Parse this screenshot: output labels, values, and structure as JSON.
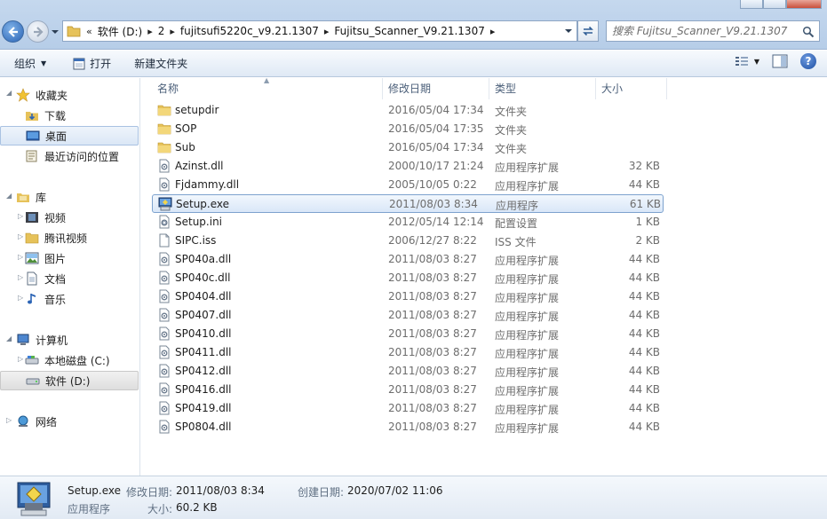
{
  "address": {
    "crumbs": [
      "软件 (D:)",
      "2",
      "fujitsufi5220c_v9.21.1307",
      "Fujitsu_Scanner_V9.21.1307"
    ],
    "overflow": "«"
  },
  "search": {
    "placeholder": "搜索 Fujitsu_Scanner_V9.21.1307"
  },
  "toolbar": {
    "organize": "组织",
    "open": "打开",
    "new_folder": "新建文件夹"
  },
  "nav": {
    "favorites": "收藏夹",
    "downloads": "下载",
    "desktop": "桌面",
    "recent": "最近访问的位置",
    "libraries": "库",
    "videos": "视频",
    "tencent_video": "腾讯视频",
    "pictures": "图片",
    "documents": "文档",
    "music": "音乐",
    "computer": "计算机",
    "local_disk": "本地磁盘 (C:)",
    "soft_disk": "软件 (D:)",
    "network": "网络"
  },
  "columns": {
    "name": "名称",
    "date": "修改日期",
    "type": "类型",
    "size": "大小"
  },
  "files": [
    {
      "name": "setupdir",
      "date": "2016/05/04 17:34",
      "type": "文件夹",
      "size": "",
      "icon": "folder"
    },
    {
      "name": "SOP",
      "date": "2016/05/04 17:35",
      "type": "文件夹",
      "size": "",
      "icon": "folder"
    },
    {
      "name": "Sub",
      "date": "2016/05/04 17:34",
      "type": "文件夹",
      "size": "",
      "icon": "folder"
    },
    {
      "name": "Azinst.dll",
      "date": "2000/10/17 21:24",
      "type": "应用程序扩展",
      "size": "32 KB",
      "icon": "dll"
    },
    {
      "name": "Fjdammy.dll",
      "date": "2005/10/05 0:22",
      "type": "应用程序扩展",
      "size": "44 KB",
      "icon": "dll"
    },
    {
      "name": "Setup.exe",
      "date": "2011/08/03 8:34",
      "type": "应用程序",
      "size": "61 KB",
      "icon": "exe"
    },
    {
      "name": "Setup.ini",
      "date": "2012/05/14 12:14",
      "type": "配置设置",
      "size": "1 KB",
      "icon": "ini"
    },
    {
      "name": "SIPC.iss",
      "date": "2006/12/27 8:22",
      "type": "ISS 文件",
      "size": "2 KB",
      "icon": "blank"
    },
    {
      "name": "SP040a.dll",
      "date": "2011/08/03 8:27",
      "type": "应用程序扩展",
      "size": "44 KB",
      "icon": "dll"
    },
    {
      "name": "SP040c.dll",
      "date": "2011/08/03 8:27",
      "type": "应用程序扩展",
      "size": "44 KB",
      "icon": "dll"
    },
    {
      "name": "SP0404.dll",
      "date": "2011/08/03 8:27",
      "type": "应用程序扩展",
      "size": "44 KB",
      "icon": "dll"
    },
    {
      "name": "SP0407.dll",
      "date": "2011/08/03 8:27",
      "type": "应用程序扩展",
      "size": "44 KB",
      "icon": "dll"
    },
    {
      "name": "SP0410.dll",
      "date": "2011/08/03 8:27",
      "type": "应用程序扩展",
      "size": "44 KB",
      "icon": "dll"
    },
    {
      "name": "SP0411.dll",
      "date": "2011/08/03 8:27",
      "type": "应用程序扩展",
      "size": "44 KB",
      "icon": "dll"
    },
    {
      "name": "SP0412.dll",
      "date": "2011/08/03 8:27",
      "type": "应用程序扩展",
      "size": "44 KB",
      "icon": "dll"
    },
    {
      "name": "SP0416.dll",
      "date": "2011/08/03 8:27",
      "type": "应用程序扩展",
      "size": "44 KB",
      "icon": "dll"
    },
    {
      "name": "SP0419.dll",
      "date": "2011/08/03 8:27",
      "type": "应用程序扩展",
      "size": "44 KB",
      "icon": "dll"
    },
    {
      "name": "SP0804.dll",
      "date": "2011/08/03 8:27",
      "type": "应用程序扩展",
      "size": "44 KB",
      "icon": "dll"
    }
  ],
  "selected_index": 5,
  "details": {
    "name": "Setup.exe",
    "type": "应用程序",
    "modified_label": "修改日期:",
    "modified": "2011/08/03 8:34",
    "size_label": "大小:",
    "size": "60.2 KB",
    "created_label": "创建日期:",
    "created": "2020/07/02 11:06"
  }
}
